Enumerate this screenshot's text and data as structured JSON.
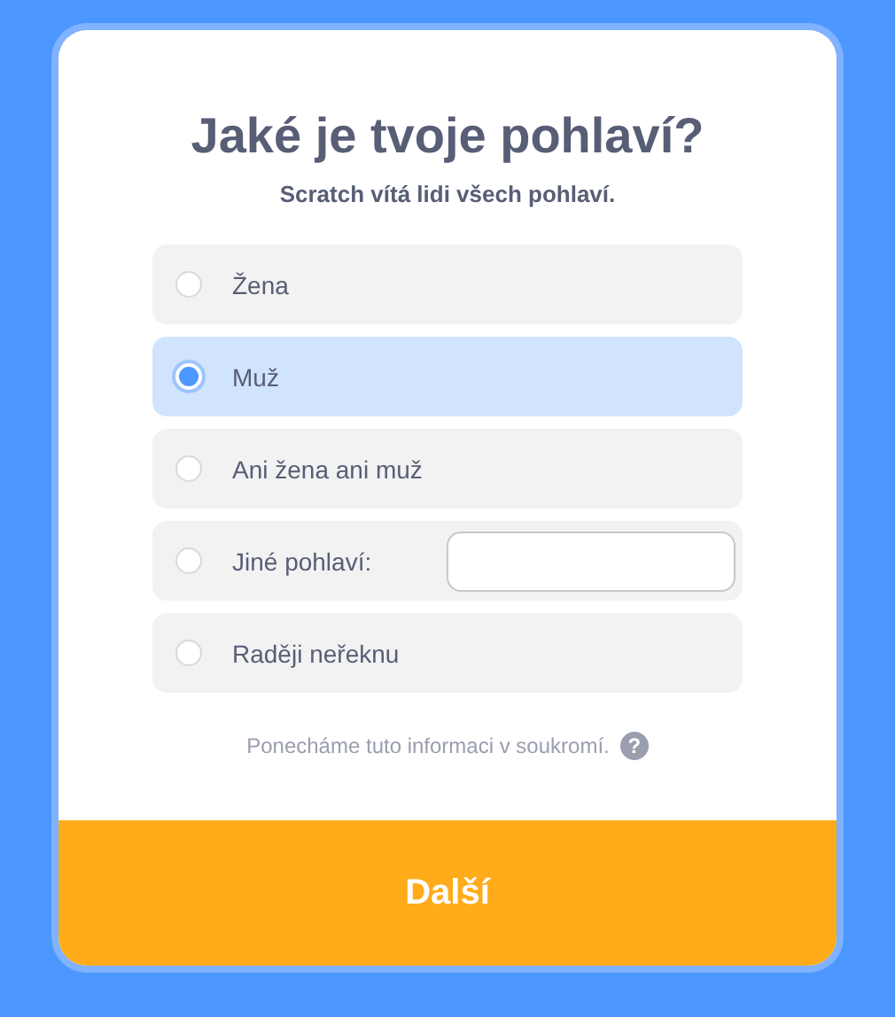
{
  "title": "Jaké je tvoje pohlaví?",
  "subtitle": "Scratch vítá lidi všech pohlaví.",
  "options": [
    {
      "kind": "plain",
      "label": "Žena",
      "selected": false
    },
    {
      "kind": "plain",
      "label": "Muž",
      "selected": true
    },
    {
      "kind": "plain",
      "label": "Ani žena ani muž",
      "selected": false
    },
    {
      "kind": "custom",
      "label": "Jiné pohlaví:",
      "selected": false
    },
    {
      "kind": "plain",
      "label": "Raději neřeknu",
      "selected": false
    }
  ],
  "privacy_note": "Ponecháme tuto informaci v soukromí.",
  "help_icon": "?",
  "next_button": "Další"
}
